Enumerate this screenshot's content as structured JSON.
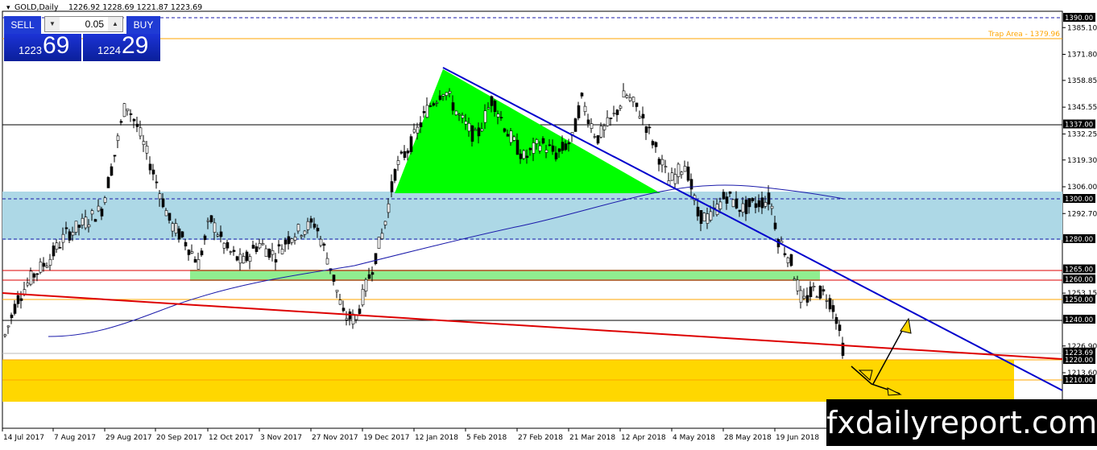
{
  "chart": {
    "symbol": "GOLD,Daily",
    "ohlc": "1226.92 1228.69 1221.87 1223.69"
  },
  "trade_panel": {
    "sell_label": "SELL",
    "buy_label": "BUY",
    "lot_value": "0.05",
    "sell_price_small": "1223",
    "sell_price_big": "69",
    "buy_price_small": "1224",
    "buy_price_big": "29"
  },
  "annotations": {
    "trap_area": "Trap Area - 1379.96",
    "watermark": "fxdailyreport.com"
  },
  "colors": {
    "zone_blue": "#add8e6",
    "zone_green": "#90ee90",
    "zone_yellow": "#ffd700",
    "triangle": "#00ff00",
    "trendline": "#0000cc",
    "support_red": "#dd0000",
    "ma": "#1a1aaa",
    "label_bg": "#000000"
  },
  "chart_data": {
    "type": "candlestick",
    "y_ticks": [
      "1385.10",
      "1371.80",
      "1358.85",
      "1345.55",
      "1332.25",
      "1319.30",
      "1306.00",
      "1292.70",
      "1253.15",
      "1226.90",
      "1213.60"
    ],
    "x_ticks": [
      "14 Jul 2017",
      "7 Aug 2017",
      "29 Aug 2017",
      "20 Sep 2017",
      "12 Oct 2017",
      "3 Nov 2017",
      "27 Nov 2017",
      "19 Dec 2017",
      "12 Jan 2018",
      "5 Feb 2018",
      "27 Feb 2018",
      "21 Mar 2018",
      "12 Apr 2018",
      "4 May 2018",
      "28 May 2018",
      "19 Jun 2018"
    ],
    "ylim": [
      1200,
      1398
    ],
    "price_labels": [
      "1390.00",
      "1337.00",
      "1300.00",
      "1280.00",
      "1265.00",
      "1260.00",
      "1250.00",
      "1240.00",
      "1223.69",
      "1220.00",
      "1210.00"
    ],
    "levels": [
      {
        "value": 1390,
        "style": "dash-blue"
      },
      {
        "value": 1379.96,
        "style": "orange"
      },
      {
        "value": 1337,
        "style": "black"
      },
      {
        "value": 1300,
        "style": "dash-blue"
      },
      {
        "value": 1280,
        "style": "dash-blue"
      },
      {
        "value": 1265,
        "style": "red"
      },
      {
        "value": 1260,
        "style": "red"
      },
      {
        "value": 1250,
        "style": "orange"
      },
      {
        "value": 1240,
        "style": "black"
      },
      {
        "value": 1223.69,
        "style": "gray"
      },
      {
        "value": 1220,
        "style": "orange"
      },
      {
        "value": 1210,
        "style": "orange"
      }
    ],
    "zones": [
      {
        "from": 1280,
        "to": 1303,
        "color": "blue"
      },
      {
        "from": 1260,
        "to": 1266,
        "color": "green"
      },
      {
        "from": 1198,
        "to": 1222,
        "color": "yellow"
      }
    ]
  }
}
